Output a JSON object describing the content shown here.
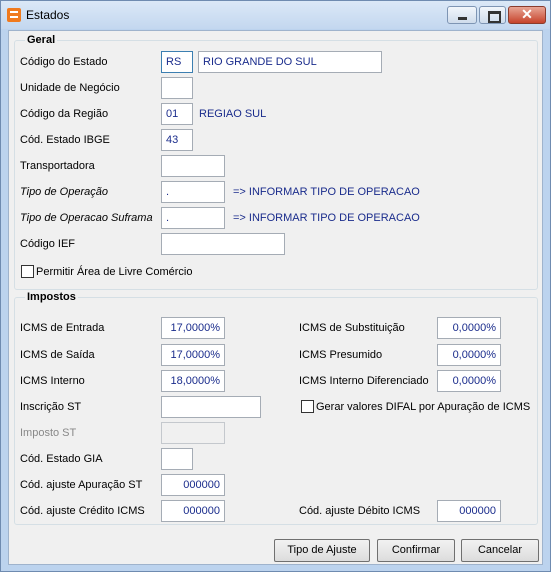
{
  "window": {
    "title": "Estados"
  },
  "geral": {
    "title": "Geral",
    "codigo_estado": {
      "label": "Código do Estado",
      "value": "RS",
      "name": "RIO GRANDE DO SUL"
    },
    "unidade_negocio": {
      "label": "Unidade de Negócio",
      "value": ""
    },
    "codigo_regiao": {
      "label": "Código da Região",
      "value": "01",
      "name": "REGIAO SUL"
    },
    "cod_estado_ibge": {
      "label": "Cód. Estado IBGE",
      "value": "43"
    },
    "transportadora": {
      "label": "Transportadora",
      "value": ""
    },
    "tipo_operacao": {
      "label": "Tipo de Operação",
      "value": ".",
      "info": "=> INFORMAR TIPO DE OPERACAO"
    },
    "tipo_operacao_suframa": {
      "label": "Tipo de Operacao Suframa",
      "value": ".",
      "info": "=> INFORMAR TIPO DE OPERACAO"
    },
    "codigo_ief": {
      "label": "Código IEF",
      "value": ""
    },
    "permitir_alc": {
      "label": "Permitir Área de Livre Comércio",
      "checked": false
    }
  },
  "impostos": {
    "title": "Impostos",
    "icms_entrada": {
      "label": "ICMS de Entrada",
      "value": "17,0000%"
    },
    "icms_saida": {
      "label": "ICMS de Saída",
      "value": "17,0000%"
    },
    "icms_interno": {
      "label": "ICMS Interno",
      "value": "18,0000%"
    },
    "inscricao_st": {
      "label": "Inscrição ST",
      "value": ""
    },
    "imposto_st": {
      "label": "Imposto ST",
      "value": ""
    },
    "cod_estado_gia": {
      "label": "Cód. Estado GIA",
      "value": ""
    },
    "cod_ajuste_apuracao_st": {
      "label": "Cód. ajuste Apuração ST",
      "value": "000000"
    },
    "cod_ajuste_credito_icms": {
      "label": "Cód. ajuste Crédito ICMS",
      "value": "000000"
    },
    "icms_substituicao": {
      "label": "ICMS de Substituição",
      "value": "0,0000%"
    },
    "icms_presumido": {
      "label": "ICMS Presumido",
      "value": "0,0000%"
    },
    "icms_interno_diferenciado": {
      "label": "ICMS Interno Diferenciado",
      "value": "0,0000%"
    },
    "gerar_difal": {
      "label": "Gerar valores DIFAL por Apuração de ICMS",
      "checked": false
    },
    "cod_ajuste_debito_icms": {
      "label": "Cód. ajuste Débito ICMS",
      "value": "000000"
    }
  },
  "buttons": {
    "tipo_ajuste": "Tipo de Ajuste",
    "confirmar": "Confirmar",
    "cancelar": "Cancelar"
  },
  "colors": {
    "value_text": "#1a2c8c",
    "title_bar": "#c3d7ef",
    "close_button": "#c6432b"
  }
}
